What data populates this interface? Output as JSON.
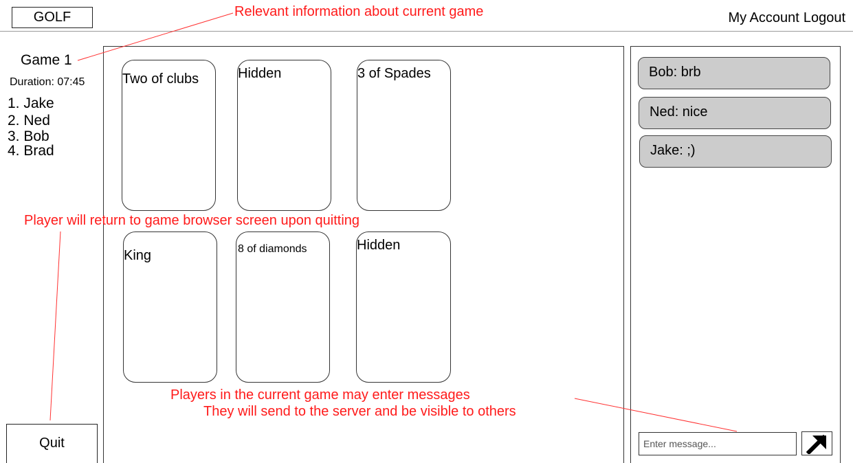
{
  "header": {
    "logo": "GOLF",
    "my_account": "My Account",
    "logout": "Logout"
  },
  "game_info": {
    "title": "Game 1",
    "duration": "Duration: 07:45",
    "players": [
      "1. Jake",
      "2. Ned",
      "3. Bob",
      "4. Brad"
    ]
  },
  "quit_label": "Quit",
  "cards": [
    {
      "label": "Two of clubs"
    },
    {
      "label": "Hidden"
    },
    {
      "label": "3 of Spades"
    },
    {
      "label": "King"
    },
    {
      "label": "8 of diamonds"
    },
    {
      "label": "Hidden"
    }
  ],
  "chat": {
    "messages": [
      "Bob: brb",
      "Ned: nice",
      "Jake: ;)"
    ],
    "input_placeholder": "Enter message...",
    "send_icon": "arrow-up-right-icon"
  },
  "annotations": {
    "game_info_note": "Relevant information about current game",
    "quit_note": "Player will return to game browser screen upon quitting",
    "chat_note_line1": "Players in the current game may enter messages",
    "chat_note_line2": "They will send to the server and be visible to others",
    "color": "#ff1a1a"
  }
}
